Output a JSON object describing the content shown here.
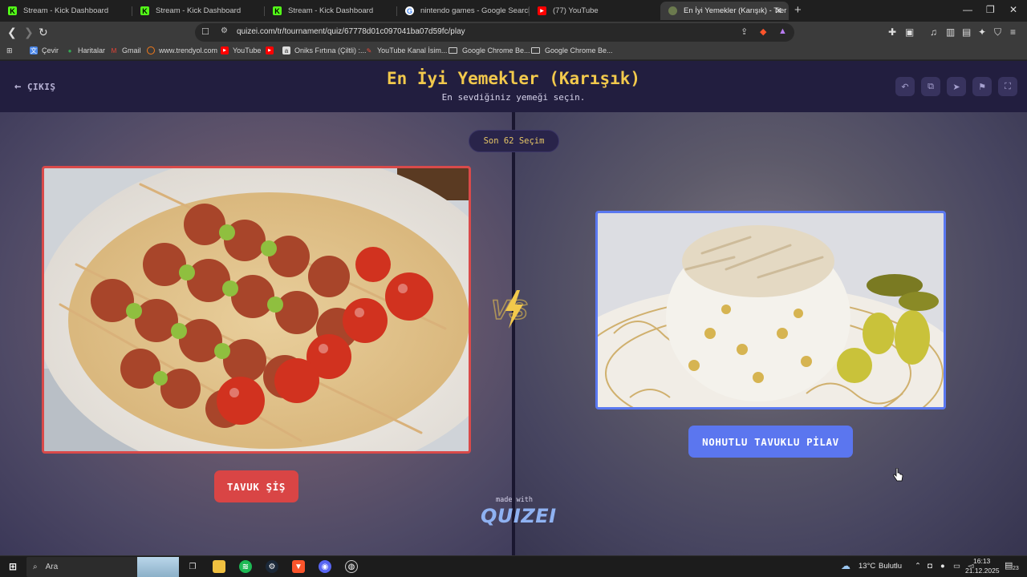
{
  "browser": {
    "tabs": [
      {
        "title": "Stream - Kick Dashboard",
        "icon": "kick-icon"
      },
      {
        "title": "Stream - Kick Dashboard",
        "icon": "kick-icon"
      },
      {
        "title": "Stream - Kick Dashboard",
        "icon": "kick-icon"
      },
      {
        "title": "nintendo games - Google Search",
        "icon": "google-icon"
      },
      {
        "title": "(77) YouTube",
        "icon": "youtube-icon"
      },
      {
        "title": "En İyi Yemekler (Karışık) - Tier Lis",
        "icon": "quizei-icon",
        "active": true
      }
    ],
    "url": "quizei.com/tr/tournament/quiz/67778d01c097041ba07d59fc/play",
    "bookmarks": [
      {
        "label": "Çevir",
        "icon": "translate-icon"
      },
      {
        "label": "Haritalar",
        "icon": "maps-icon"
      },
      {
        "label": "Gmail",
        "icon": "gmail-icon"
      },
      {
        "label": "www.trendyol.com",
        "icon": "trendyol-icon"
      },
      {
        "label": "YouTube",
        "icon": "youtube-icon"
      },
      {
        "label": "",
        "icon": "youtube-icon"
      },
      {
        "label": "Oniks Fırtına (Çiltli) :...",
        "icon": "book-icon"
      },
      {
        "label": "YouTube Kanal İsim...",
        "icon": "pen-icon"
      },
      {
        "label": "Google Chrome Be...",
        "icon": "folder-icon"
      },
      {
        "label": "Google Chrome Be...",
        "icon": "folder-icon"
      }
    ]
  },
  "page": {
    "exit_label": "ÇIKIŞ",
    "title": "En İyi Yemekler (Karışık)",
    "subtitle": "En sevdiğiniz yemeği seçin.",
    "round_label": "Son 62 Seçim",
    "left_choice": {
      "label": "TAVUK ŞİŞ",
      "color": "#d94545"
    },
    "right_choice": {
      "label": "NOHUTLU TAVUKLU PİLAV",
      "color": "#5b76ef"
    },
    "vs_text": "VS",
    "made_with": "made with",
    "brand": "QUIZEI",
    "accent": "#f2c94c"
  },
  "taskbar": {
    "search_placeholder": "Ara",
    "weather_temp": "13°C",
    "weather_desc": "Bulutlu",
    "time": "16:13",
    "date": "21.12.2025",
    "notification_count": "23"
  }
}
